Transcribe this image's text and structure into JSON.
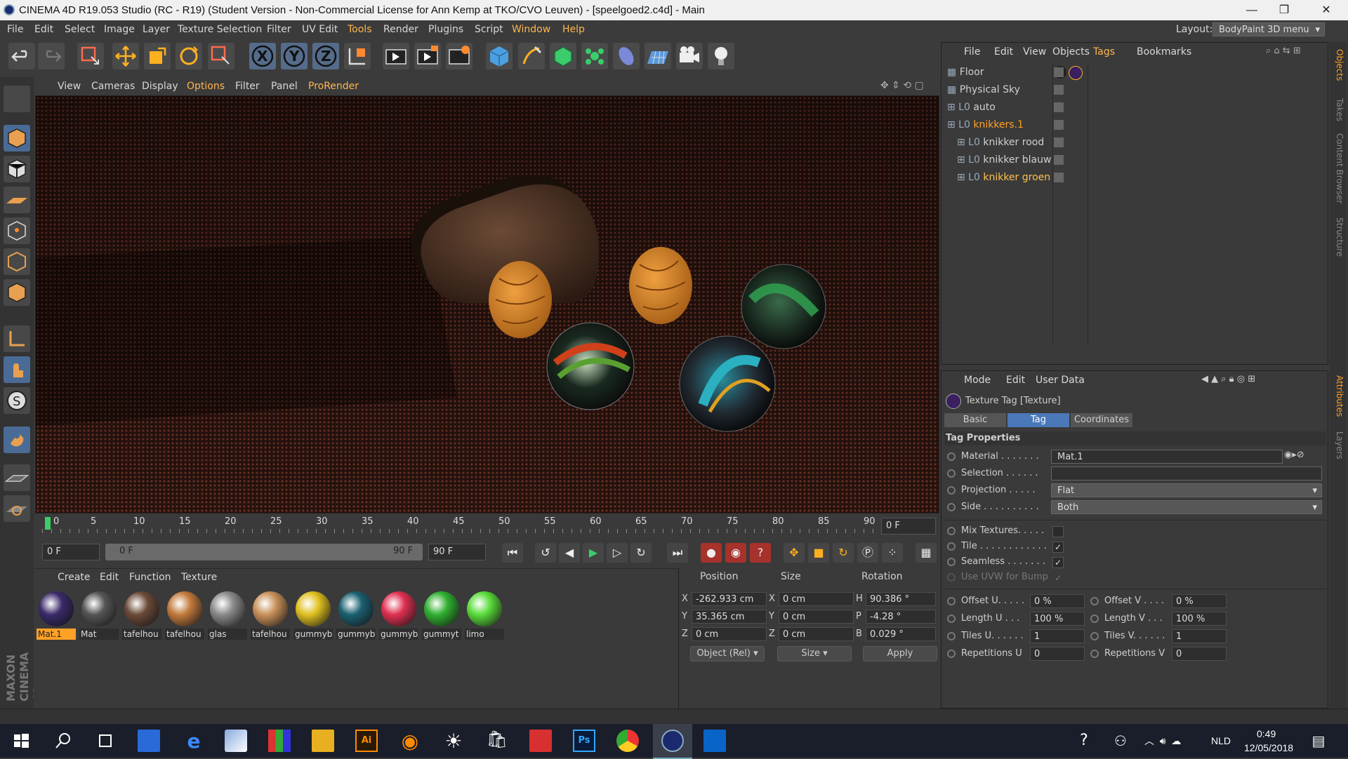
{
  "window": {
    "title": "CINEMA 4D R19.053 Studio (RC - R19) (Student Version - Non-Commercial License for Ann Kemp at TKO/CVO Leuven) - [speelgoed2.c4d] - Main",
    "min": "—",
    "max": "❐",
    "close": "✕"
  },
  "menubar": {
    "items": [
      "File",
      "Edit",
      "Select",
      "Image",
      "Layer",
      "Texture Selection",
      "Filter",
      "UV Edit",
      "Tools",
      "Render",
      "Plugins",
      "Script",
      "Window",
      "Help"
    ],
    "layout_label": "Layout:",
    "layout_value": "BodyPaint 3D menu"
  },
  "toolbar": {
    "icons": [
      "undo-icon",
      "redo-icon",
      "live-selection-icon",
      "move-icon",
      "scale-icon",
      "rotate-icon",
      "selection-icon",
      "x-axis-icon",
      "y-axis-icon",
      "z-axis-icon",
      "coordinate-system-icon",
      "render-view-icon",
      "render-picture-viewer-icon",
      "edit-render-settings-icon",
      "cube-icon",
      "pen-icon",
      "subdivision-icon",
      "cloner-icon",
      "deformer-icon",
      "floor-icon",
      "camera-icon",
      "light-icon"
    ],
    "x": "X",
    "y": "Y",
    "z": "Z"
  },
  "viewport": {
    "menus": [
      "View",
      "Cameras",
      "Display",
      "Options",
      "Filter",
      "Panel",
      "ProRender"
    ]
  },
  "timeline": {
    "ticks": [
      "0",
      "5",
      "10",
      "15",
      "20",
      "25",
      "30",
      "35",
      "40",
      "45",
      "50",
      "55",
      "60",
      "65",
      "70",
      "75",
      "80",
      "85",
      "90"
    ],
    "current_frame": "0 F"
  },
  "playbar": {
    "start": "0 F",
    "range_start": "0 F",
    "range_end": "90 F",
    "end": "90 F"
  },
  "materials": {
    "menus": [
      "Create",
      "Edit",
      "Function",
      "Texture"
    ],
    "items": [
      {
        "name": "Mat.1",
        "color": "#3a2a6a"
      },
      {
        "name": "Mat",
        "color": "#555555"
      },
      {
        "name": "tafelhou",
        "color": "#6b4a38"
      },
      {
        "name": "tafelhou",
        "color": "#c27a3c"
      },
      {
        "name": "glas",
        "color": "#8a8a8a"
      },
      {
        "name": "tafelhou",
        "color": "#c9915a"
      },
      {
        "name": "gummyb",
        "color": "#e0c020"
      },
      {
        "name": "gummyb",
        "color": "#1a6070"
      },
      {
        "name": "gummyb",
        "color": "#e03050"
      },
      {
        "name": "gummyt",
        "color": "#30b030"
      },
      {
        "name": "limo",
        "color": "#5adc3a"
      }
    ]
  },
  "coords": {
    "headers": [
      "Position",
      "Size",
      "Rotation"
    ],
    "rows": [
      {
        "axis": "X",
        "pos": "-262.933 cm",
        "saxis": "X",
        "size": "0 cm",
        "raxis": "H",
        "rot": "90.386 °"
      },
      {
        "axis": "Y",
        "pos": "35.365 cm",
        "saxis": "Y",
        "size": "0 cm",
        "raxis": "P",
        "rot": "-4.28 °"
      },
      {
        "axis": "Z",
        "pos": "0 cm",
        "saxis": "Z",
        "size": "0 cm",
        "raxis": "B",
        "rot": "0.029 °"
      }
    ],
    "mode": "Object (Rel)",
    "size_mode": "Size",
    "apply": "Apply"
  },
  "objects": {
    "menus": [
      "File",
      "Edit",
      "View",
      "Objects",
      "Tags",
      "Bookmarks"
    ],
    "rows": [
      {
        "name": "Floor",
        "indent": 0,
        "color": "#cfcfcf"
      },
      {
        "name": "Physical Sky",
        "indent": 0,
        "color": "#cfcfcf"
      },
      {
        "name": "auto",
        "indent": 0,
        "color": "#cfcfcf"
      },
      {
        "name": "knikkers.1",
        "indent": 0,
        "color": "#ffa126"
      },
      {
        "name": "knikker rood",
        "indent": 1,
        "color": "#cfcfcf"
      },
      {
        "name": "knikker blauw",
        "indent": 1,
        "color": "#cfcfcf"
      },
      {
        "name": "knikker groen",
        "indent": 1,
        "color": "#ffc04d"
      }
    ]
  },
  "attributes": {
    "menus": [
      "Mode",
      "Edit",
      "User Data"
    ],
    "header": "Texture Tag [Texture]",
    "tabs": [
      "Basic",
      "Tag",
      "Coordinates"
    ],
    "section": "Tag Properties",
    "material_label": "Material . . . . . . .",
    "material_value": "Mat.1",
    "selection_label": "Selection . . . . . .",
    "projection_label": "Projection . . . . .",
    "projection_value": "Flat",
    "side_label": "Side . . . . . . . . . .",
    "side_value": "Both",
    "mix_label": "Mix Textures. . . . .",
    "tile_label": "Tile . . . . . . . . . . . .",
    "seamless_label": "Seamless . . . . . . .",
    "uvw_label": "Use UVW for Bump",
    "check": "✓",
    "offset_u_label": "Offset U. . . . .",
    "offset_u": "0 %",
    "offset_v_label": "Offset V . . . .",
    "offset_v": "0 %",
    "length_u_label": "Length U . . .",
    "length_u": "100 %",
    "length_v_label": "Length V . . .",
    "length_v": "100 %",
    "tiles_u_label": "Tiles U. . . . . .",
    "tiles_u": "1",
    "tiles_v_label": "Tiles V. . . . . .",
    "tiles_v": "1",
    "rep_u_label": "Repetitions U",
    "rep_u": "0",
    "rep_v_label": "Repetitions V",
    "rep_v": "0"
  },
  "sidetabs": {
    "top": [
      "Objects",
      "Takes",
      "Content Browser",
      "Structure"
    ],
    "bottom": [
      "Attributes",
      "Layers"
    ]
  },
  "brand": "MAXON CINEMA 4D",
  "taskbar": {
    "lang": "NLD",
    "time": "0:49",
    "date": "12/05/2018"
  }
}
